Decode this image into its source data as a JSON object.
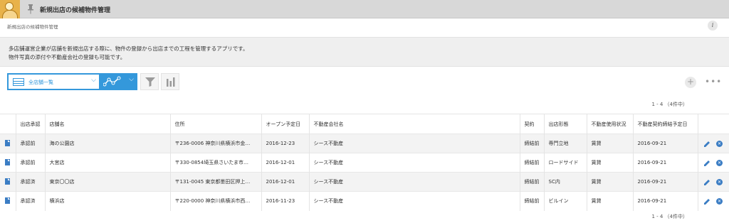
{
  "header": {
    "app_title": "新規出店の候補物件管理",
    "breadcrumb": "新規出店の候補物件管理",
    "info_label": "i"
  },
  "description": {
    "line1": "多店舗運営企業が店舗を新規出店する際に、物件の登録から出店までの工程を管理するアプリです。",
    "line2": "物件写真の添付や不動産会社の登録も可能です。"
  },
  "toolbar": {
    "view_label": "全店舗一覧",
    "add_label": "+",
    "more_label": "•••"
  },
  "pagination": {
    "top": "1 - 4 （4件中）",
    "bottom": "1 - 4 （4件中）"
  },
  "table": {
    "columns": [
      "出店承認",
      "店舗名",
      "住所",
      "オープン予定日",
      "不動産会社名",
      "契約",
      "出店形態",
      "不動産使用状況",
      "不動産契約締結予定日"
    ],
    "rows": [
      {
        "approval": "承認前",
        "store": "海の公園店",
        "address": "〒236-0006 神奈川県横浜市金…",
        "open_date": "2016-12-23",
        "company": "シース不動産",
        "contract": "締結前",
        "format": "専門立地",
        "usage": "賃貸",
        "sign_date": "2016-09-21"
      },
      {
        "approval": "承認前",
        "store": "大宮店",
        "address": "〒330-0854埼玉県さいたま市…",
        "open_date": "2016-12-01",
        "company": "シース不動産",
        "contract": "締結前",
        "format": "ロードサイド",
        "usage": "賃貸",
        "sign_date": "2016-09-21"
      },
      {
        "approval": "承認済",
        "store": "東京〇〇店",
        "address": "〒131-0045 東京都墨田区押上…",
        "open_date": "2016-12-01",
        "company": "シース不動産",
        "contract": "締結前",
        "format": "SC内",
        "usage": "賃貸",
        "sign_date": "2016-09-21"
      },
      {
        "approval": "承認済",
        "store": "横浜店",
        "address": "〒220-0000 神奈川県横浜市西…",
        "open_date": "2016-11-23",
        "company": "シース不動産",
        "contract": "締結前",
        "format": "ビルイン",
        "usage": "賃貸",
        "sign_date": "2016-09-21"
      }
    ]
  },
  "colors": {
    "accent": "#3498db",
    "icon_blue": "#3b7dc4",
    "header_bg": "#d8d8d8",
    "description_bg": "#efefef"
  }
}
